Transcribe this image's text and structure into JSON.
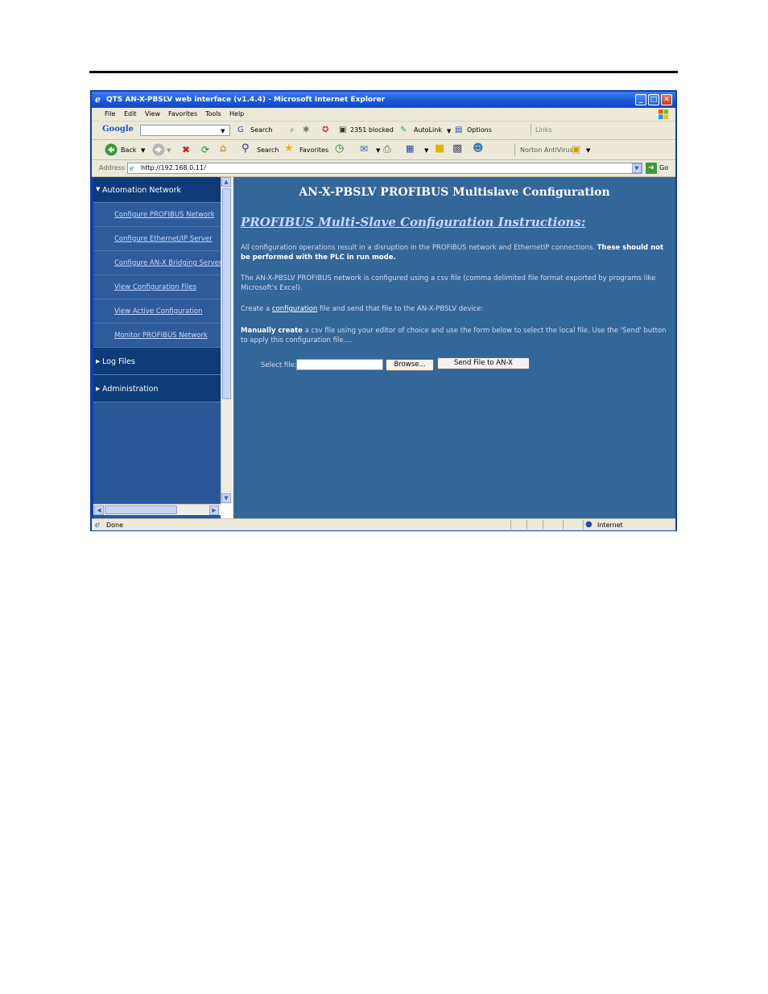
{
  "window": {
    "title": "QTS AN-X-PBSLV web interface (v1.4.4) - Microsoft Internet Explorer",
    "minimize": "_",
    "maximize": "□",
    "close": "✕"
  },
  "menu": [
    "File",
    "Edit",
    "View",
    "Favorites",
    "Tools",
    "Help"
  ],
  "google_bar": {
    "logo": "Google",
    "search": "Search",
    "blocked": "2351 blocked",
    "autolink": "AutoLink",
    "options": "Options",
    "links": "Links"
  },
  "toolbar": {
    "back": "Back",
    "search": "Search",
    "favorites": "Favorites",
    "norton": "Norton AntiVirus"
  },
  "address": {
    "label": "Address",
    "url": "http://192.168.0.11/",
    "go": "Go"
  },
  "sidebar": {
    "sections": [
      {
        "label": "Automation Network",
        "expanded": true
      },
      {
        "label": "Log Files",
        "expanded": false
      },
      {
        "label": "Administration",
        "expanded": false
      }
    ],
    "items": [
      "Configure PROFIBUS Network",
      "Configure Ethernet/IP Server",
      "Configure AN-X Bridging Server",
      "View Configuration Files",
      "View Active Configuration",
      "Monitor PROFIBUS Network"
    ]
  },
  "content": {
    "title": "AN-X-PBSLV PROFIBUS Multislave Configuration",
    "subtitle": "PROFIBUS Multi-Slave Configuration Instructions:",
    "p1_text": "All configuration operations result in a disruption in the PROFIBUS network and EthernetIP connections. ",
    "p1_bold": "These should not be performed with the PLC in run mode.",
    "p2": "The AN-X-PBSLV PROFIBUS network is configured using a csv file (comma delimited file format exported by programs like Microsoft's Excel).",
    "p3_pre": "Create a ",
    "p3_link": "configuration",
    "p3_post": " file and send that file to the AN-X-PBSLV device:",
    "p4_bold": "Manually create",
    "p4_text": " a csv file using your editor of choice and use the form below to select the local file. Use the 'Send' button to apply this configuration file....",
    "select_label": "Select file:",
    "browse": "Browse...",
    "send": "Send File to AN-X"
  },
  "status": {
    "left": "Done",
    "zone": "Internet"
  },
  "colors": {
    "content_bg": "#336699",
    "sidebar_head": "#0d3c78",
    "titlebar": "#1a56d6"
  }
}
